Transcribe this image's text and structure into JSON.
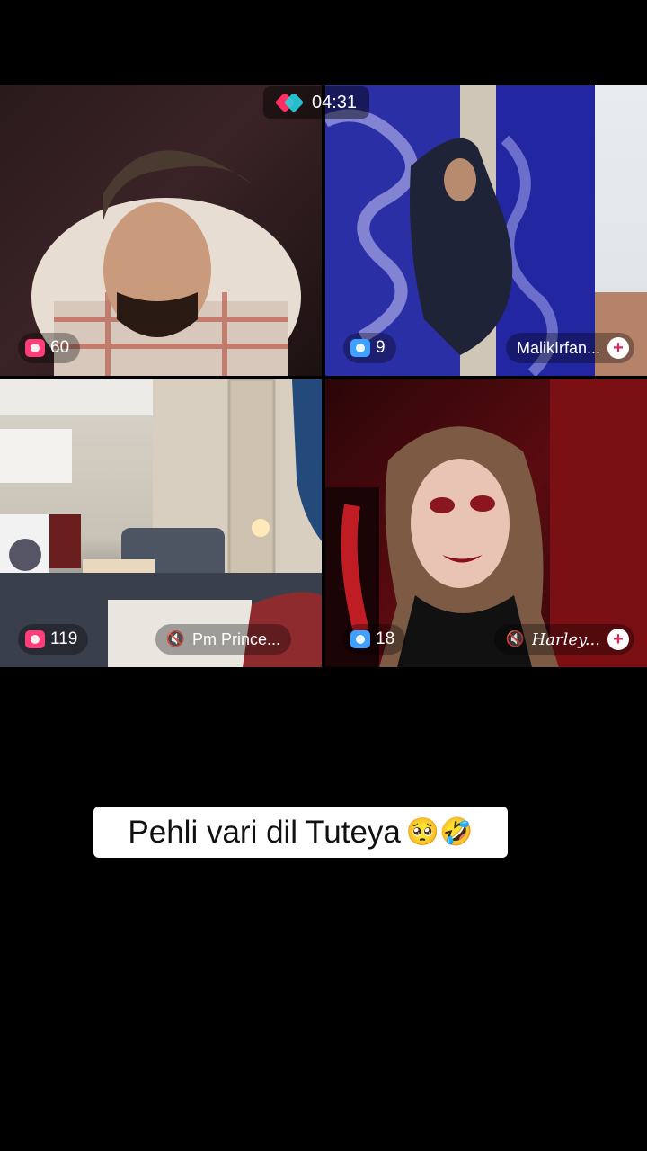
{
  "timer": {
    "icon": "live-duo-icon",
    "time": "04:31"
  },
  "tiles": [
    {
      "viewer_icon": "camera-icon",
      "viewers": "60",
      "name": ""
    },
    {
      "viewer_icon": "camera-icon",
      "viewers": "9",
      "name": "MalikIrfan...",
      "muted": false,
      "follow": "+"
    },
    {
      "viewer_icon": "camera-icon",
      "viewers": "119",
      "name": "Pm Prince...",
      "muted": true,
      "mute_icon": "🔇"
    },
    {
      "viewer_icon": "camera-icon",
      "viewers": "18",
      "name": "Harley...",
      "muted": true,
      "mute_icon": "🔇",
      "follow": "+"
    }
  ],
  "caption": {
    "text": "Pehli vari dil Tuteya",
    "emoji": "🥺🤣"
  },
  "colors": {
    "accent_pink": "#ff3d78",
    "accent_blue": "#3fa0ff"
  }
}
